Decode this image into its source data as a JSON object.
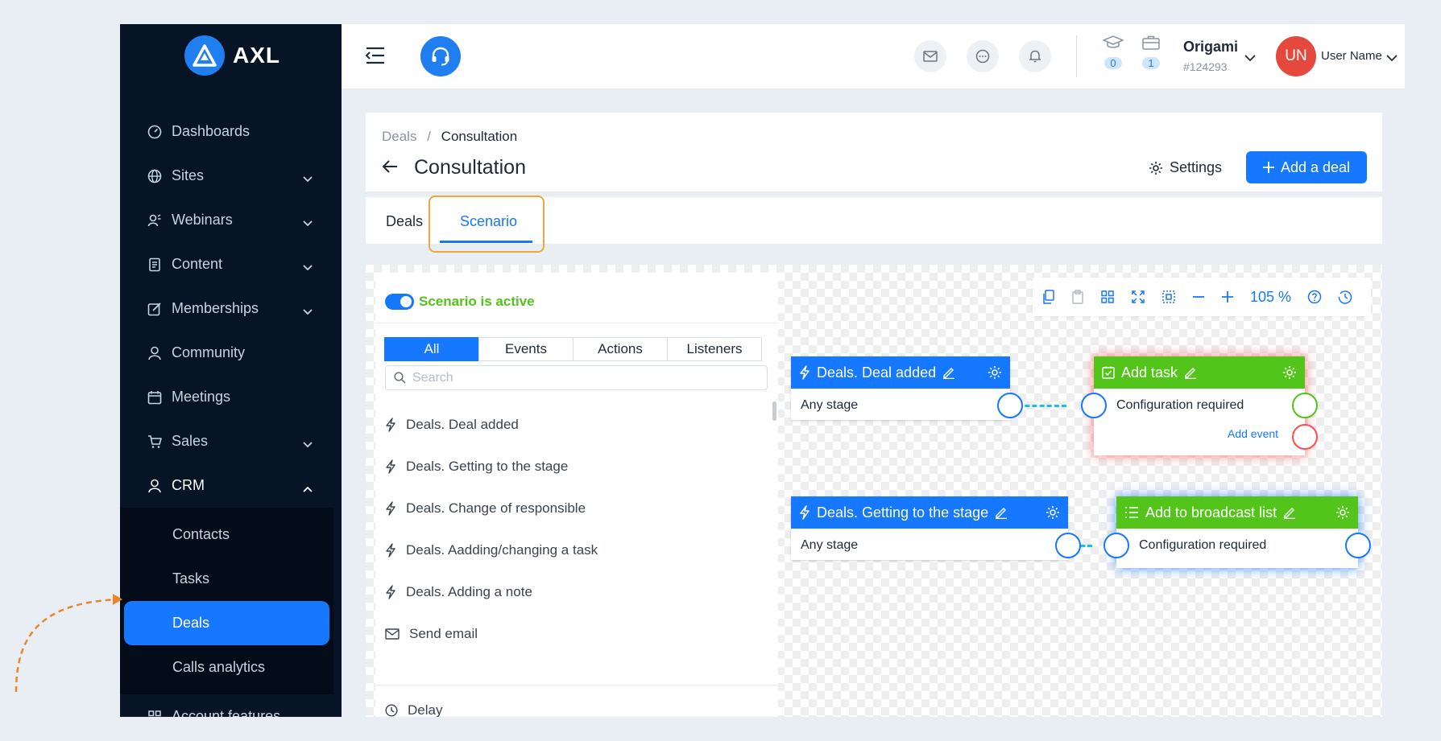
{
  "brand": {
    "name": "AXL"
  },
  "sidebar": {
    "items": [
      {
        "label": "Dashboards",
        "icon": "dashboard-icon",
        "has_chevron": false
      },
      {
        "label": "Sites",
        "icon": "globe-icon",
        "has_chevron": true
      },
      {
        "label": "Webinars",
        "icon": "webinar-icon",
        "has_chevron": true
      },
      {
        "label": "Content",
        "icon": "content-icon",
        "has_chevron": true
      },
      {
        "label": "Memberships",
        "icon": "edit-icon",
        "has_chevron": true
      },
      {
        "label": "Community",
        "icon": "user-icon",
        "has_chevron": false
      },
      {
        "label": "Meetings",
        "icon": "calendar-icon",
        "has_chevron": false
      },
      {
        "label": "Sales",
        "icon": "cart-icon",
        "has_chevron": true
      },
      {
        "label": "CRM",
        "icon": "user-icon",
        "has_chevron": true,
        "expanded": true
      }
    ],
    "crm_sub": [
      {
        "label": "Contacts"
      },
      {
        "label": "Tasks"
      },
      {
        "label": "Deals",
        "active": true
      },
      {
        "label": "Calls analytics"
      }
    ],
    "account_features": "Account features"
  },
  "topbar": {
    "counters": [
      {
        "icon": "graduation-cap-icon",
        "value": "0"
      },
      {
        "icon": "briefcase-icon",
        "value": "1"
      }
    ],
    "company_name": "Origami",
    "company_id": "#124293",
    "avatar_initials": "UN",
    "user_name": "User Name"
  },
  "header": {
    "breadcrumb_parent": "Deals",
    "breadcrumb_sep": "/",
    "breadcrumb_current": "Consultation",
    "title": "Consultation",
    "settings_label": "Settings",
    "add_label": "Add a deal"
  },
  "tabs": [
    {
      "label": "Deals"
    },
    {
      "label": "Scenario",
      "active": true
    }
  ],
  "scenario_panel": {
    "status_label": "Scenario is active",
    "filters": [
      "All",
      "Events",
      "Actions",
      "Listeners"
    ],
    "search_placeholder": "Search",
    "items": [
      {
        "label": "Deals. Deal added",
        "icon": "lightning-icon"
      },
      {
        "label": "Deals. Getting to the stage",
        "icon": "lightning-icon"
      },
      {
        "label": "Deals. Change of responsible",
        "icon": "lightning-icon"
      },
      {
        "label": "Deals. Aadding/changing a task",
        "icon": "lightning-icon"
      },
      {
        "label": "Deals. Adding a note",
        "icon": "lightning-icon"
      },
      {
        "label": "Send email",
        "icon": "envelope-icon"
      }
    ],
    "delay_label": "Delay"
  },
  "toolbar": {
    "zoom": "105 %"
  },
  "nodes": {
    "deal_added": {
      "title": "Deals. Deal added",
      "body": "Any stage"
    },
    "add_task": {
      "title": "Add task",
      "body": "Configuration required",
      "add_event": "Add event"
    },
    "getting_stage": {
      "title": "Deals. Getting to the stage",
      "body": "Any stage"
    },
    "broadcast": {
      "title": "Add to broadcast list",
      "body": "Configuration required"
    }
  },
  "colors": {
    "primary": "#1677ff",
    "success": "#52c41a",
    "danger": "#ff4d4f",
    "sidebar": "#061426",
    "highlight": "#f0a63a"
  }
}
